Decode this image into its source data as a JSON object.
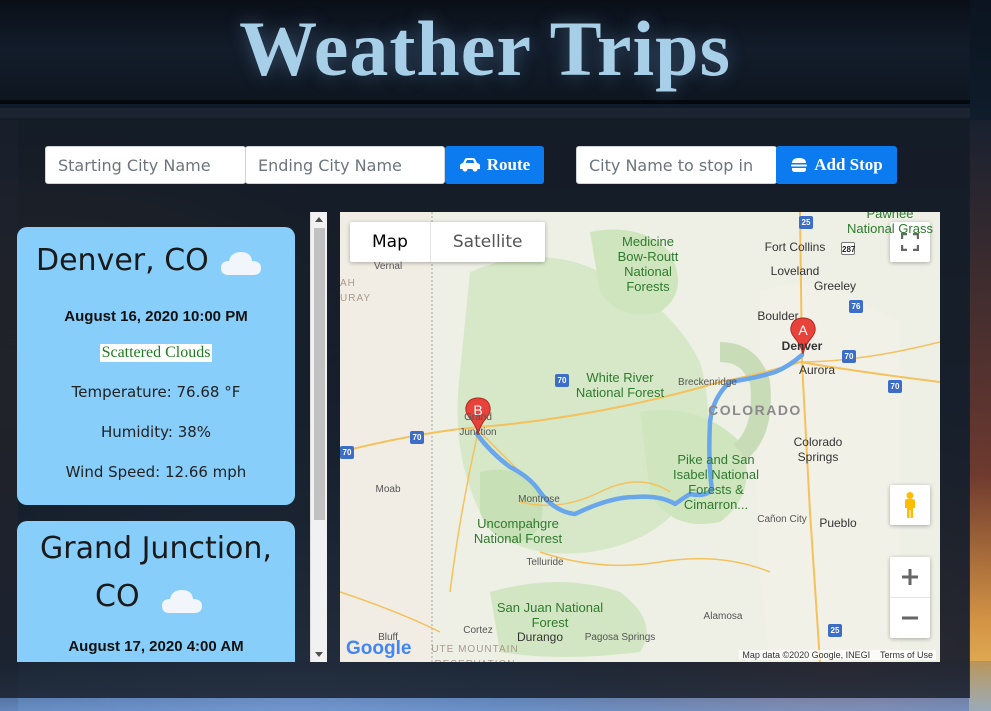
{
  "header": {
    "title": "Weather Trips"
  },
  "route_form": {
    "start_placeholder": "Starting City Name",
    "end_placeholder": "Ending City Name",
    "route_label": "Route"
  },
  "stop_form": {
    "stop_placeholder": "City Name to stop in",
    "add_stop_label": "Add Stop"
  },
  "weather_cards": [
    {
      "city": "Denver, CO",
      "date": "August 16, 2020 10:00 PM",
      "description": "Scattered Clouds",
      "temperature": "Temperature: 76.68 °F",
      "humidity": "Humidity: 38%",
      "wind": "Wind Speed: 12.66 mph",
      "icon": "cloud-icon"
    },
    {
      "city_line1": "Grand Junction,",
      "city_line2": "CO",
      "date": "August 17, 2020 4:00 AM",
      "icon": "cloud-icon"
    }
  ],
  "map": {
    "tabs": [
      "Map",
      "Satellite"
    ],
    "active_tab": "Map",
    "markers": [
      "A",
      "B"
    ],
    "state_label": "COLORADO",
    "attribution": "Map data ©2020 Google, INEGI",
    "terms": "Terms of Use",
    "logo": "Google",
    "labels": {
      "fort_collins": "Fort Collins",
      "loveland": "Loveland",
      "greeley": "Greeley",
      "boulder": "Boulder",
      "denver": "Denver",
      "aurora": "Aurora",
      "breckenridge": "Breckenridge",
      "colorado_springs": "Colorado Springs",
      "pueblo": "Pueblo",
      "canon_city": "Cañon City",
      "montrose": "Montrose",
      "telluride": "Telluride",
      "grand_junction": "Grand Junction",
      "moab": "Moab",
      "vernal": "Vernal",
      "cortez": "Cortez",
      "durango": "Durango",
      "pagosa_springs": "Pagosa Springs",
      "alamosa": "Alamosa",
      "bluff": "Bluff",
      "medicine_bow": "Medicine Bow-Routt National Forests",
      "white_river": "White River National Forest",
      "pike_san_isabel": "Pike and San Isabel National Forests & Cimarron...",
      "uncompahgre": "Uncompahgre National Forest",
      "san_juan": "San Juan National Forest",
      "pawnee": "Pawnee National Grass",
      "ute_mountain": "UTE MOUNTAIN RESERVATION",
      "utah_ray": "AH URAY"
    }
  }
}
